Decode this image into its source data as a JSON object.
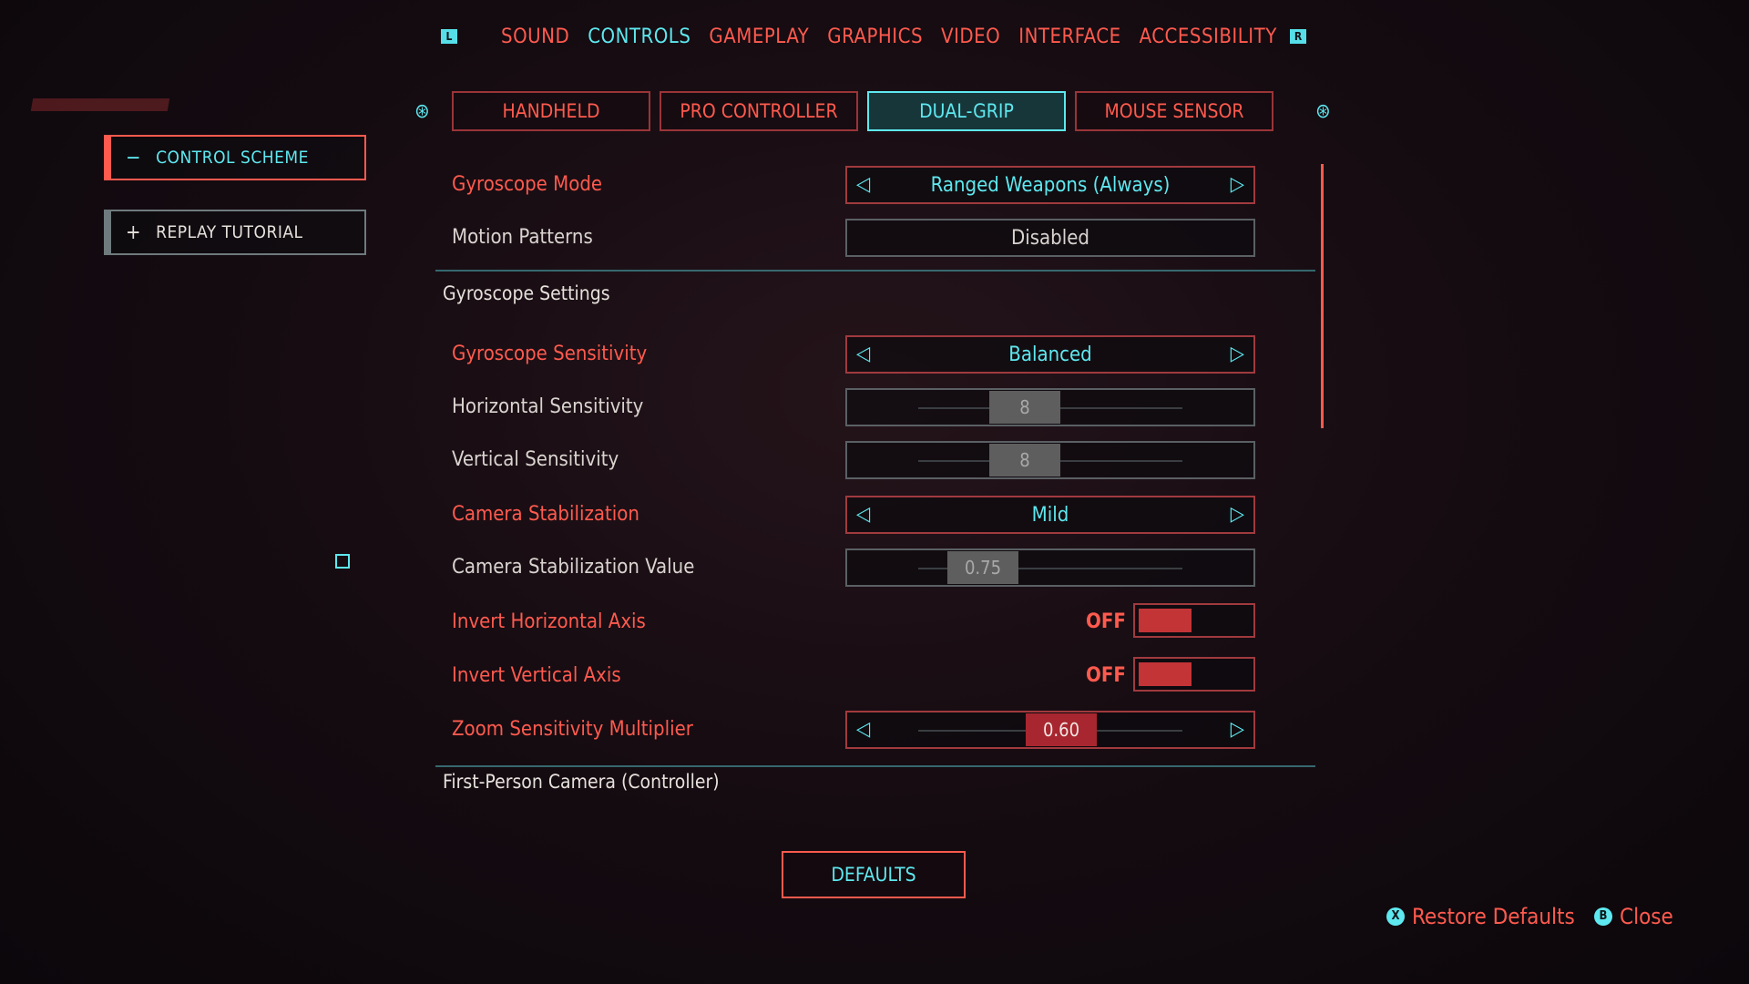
{
  "bumpers": {
    "left": "L",
    "right": "R"
  },
  "top_nav": [
    {
      "label": "SOUND",
      "active": false
    },
    {
      "label": "CONTROLS",
      "active": true
    },
    {
      "label": "GAMEPLAY",
      "active": false
    },
    {
      "label": "GRAPHICS",
      "active": false
    },
    {
      "label": "VIDEO",
      "active": false
    },
    {
      "label": "INTERFACE",
      "active": false
    },
    {
      "label": "ACCESSIBILITY",
      "active": false
    }
  ],
  "left_menu": {
    "control_scheme": {
      "symbol": "−",
      "label": "CONTROL SCHEME"
    },
    "replay_tutorial": {
      "symbol": "+",
      "label": "REPLAY TUTORIAL"
    }
  },
  "sub_tabs": [
    {
      "label": "HANDHELD",
      "active": false
    },
    {
      "label": "PRO CONTROLLER",
      "active": false
    },
    {
      "label": "DUAL-GRIP",
      "active": true
    },
    {
      "label": "MOUSE SENSOR",
      "active": false
    }
  ],
  "settings": {
    "gyroscope_mode": {
      "label": "Gyroscope Mode",
      "value": "Ranged Weapons (Always)"
    },
    "motion_patterns": {
      "label": "Motion Patterns",
      "value": "Disabled"
    },
    "section_gyro": "Gyroscope Settings",
    "gyroscope_sensitivity": {
      "label": "Gyroscope Sensitivity",
      "value": "Balanced"
    },
    "horizontal_sensitivity": {
      "label": "Horizontal Sensitivity",
      "value": "8"
    },
    "vertical_sensitivity": {
      "label": "Vertical Sensitivity",
      "value": "8"
    },
    "camera_stabilization": {
      "label": "Camera Stabilization",
      "value": "Mild"
    },
    "camera_stabilization_value": {
      "label": "Camera Stabilization Value",
      "value": "0.75"
    },
    "invert_horizontal": {
      "label": "Invert Horizontal Axis",
      "value": "OFF"
    },
    "invert_vertical": {
      "label": "Invert Vertical Axis",
      "value": "OFF"
    },
    "zoom_sensitivity": {
      "label": "Zoom Sensitivity Multiplier",
      "value": "0.60"
    },
    "section_camera": "First-Person Camera (Controller)"
  },
  "defaults_button": "DEFAULTS",
  "footer": {
    "restore": {
      "button": "X",
      "label": "Restore Defaults"
    },
    "close": {
      "button": "B",
      "label": "Close"
    }
  },
  "colors": {
    "accent_red": "#ff5a4e",
    "accent_cyan": "#5ee8ef"
  }
}
